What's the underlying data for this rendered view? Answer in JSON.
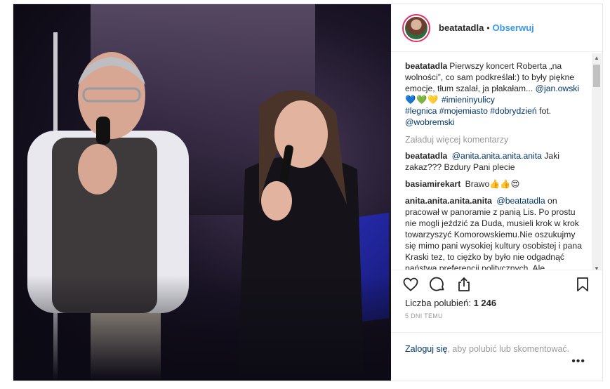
{
  "post": {
    "username": "beatatadla",
    "separator": "•",
    "follow_label": "Obserwuj",
    "caption": {
      "username": "beatatadla",
      "text": "Pierwszy koncert Roberta „na wolności”, co sam podkreślał:) to były piękne emocje, tłum szalał, ja płakałam...",
      "mention": "@jan.owski",
      "hearts": [
        "💙",
        "💚",
        "💛"
      ],
      "tag1": "#imieninyulicy",
      "tags_line": "#legnica #mojemiasto #dobrydzień",
      "fot_label": "fot.",
      "photo_credit": "@wobremski"
    },
    "load_more_label": "Załaduj więcej komentarzy",
    "comments": [
      {
        "username": "beatatadla",
        "mention": "@anita.anita.anita.anita",
        "text": "Jaki zakaz??? Bzdury Pani plecie"
      },
      {
        "username": "basiamirekart",
        "text": "Brawo👍👍😍"
      },
      {
        "username": "anita.anita.anita.anita",
        "mention": "@beatatadla",
        "text": "on pracował w panoramie z panią Lis. Po prostu nie mogli jeździć za Duda, musieli krok w krok towarzyszyć Komorowskiemu.Nie oszukujmy się mimo pani wysokiej kultury osobistej i pana Kraski tez, to ciężko by było nie odgadnąć państwa preferencji politycznych. Ale"
      }
    ],
    "icons": {
      "like": "heart-icon",
      "comment": "comment-icon",
      "share": "share-icon",
      "save": "bookmark-icon",
      "more": "more-icon"
    },
    "likes_label": "Liczba polubień:",
    "likes_count": "1 246",
    "time_ago": "5 DNI TEMU",
    "login_link": "Zaloguj się",
    "login_text": ", aby polubić lub skomentować.",
    "more_label": "•••"
  }
}
